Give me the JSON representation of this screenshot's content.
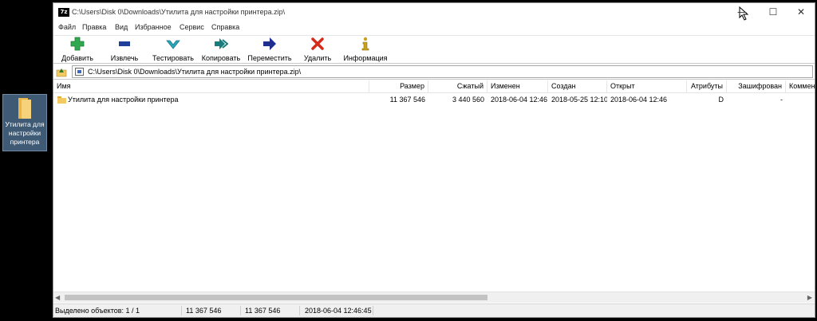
{
  "window": {
    "title": "C:\\Users\\Disk 0\\Downloads\\Утилита для настройки принтера.zip\\",
    "app_icon_text": "7z",
    "buttons": {
      "minimize": "—",
      "maximize": "☐",
      "close": "✕"
    }
  },
  "menu": [
    "Файл",
    "Правка",
    "Вид",
    "Избранное",
    "Сервис",
    "Справка"
  ],
  "toolbar": [
    {
      "label": "Добавить",
      "icon": "plus-icon",
      "color": "#2fa84f"
    },
    {
      "label": "Извлечь",
      "icon": "minus-icon",
      "color": "#1f3f9b"
    },
    {
      "label": "Тестировать",
      "icon": "check-icon",
      "color": "#2aa6b8"
    },
    {
      "label": "Копировать",
      "icon": "double-arrow-icon",
      "color": "#1a7d7d"
    },
    {
      "label": "Переместить",
      "icon": "arrow-right-icon",
      "color": "#1f2f8f"
    },
    {
      "label": "Удалить",
      "icon": "x-icon",
      "color": "#d62a1a"
    },
    {
      "label": "Информация",
      "icon": "info-icon",
      "color": "#c9a21a"
    }
  ],
  "address": {
    "path": "C:\\Users\\Disk 0\\Downloads\\Утилита для настройки принтера.zip\\"
  },
  "columns": [
    "Имя",
    "Размер",
    "Сжатый",
    "Изменен",
    "Создан",
    "Открыт",
    "Атрибуты",
    "Зашифрован",
    "Коммен"
  ],
  "rows": [
    {
      "name": "Утилита для настройки принтера",
      "size": "11 367 546",
      "packed": "3 440 560",
      "modified": "2018-06-04 12:46",
      "created": "2018-05-25 12:10",
      "opened": "2018-06-04 12:46",
      "attributes": "D",
      "encrypted": "-",
      "comment": ""
    }
  ],
  "status": {
    "selected": "Выделено объектов: 1 / 1",
    "size": "11 367 546",
    "packed": "11 367 546",
    "date": "2018-06-04 12:46:45"
  },
  "desktop_icon": {
    "label": "Утилита для настройки принтера",
    "icon": "folder-icon"
  },
  "scrollbar": {
    "left": "◀",
    "right": "▶"
  }
}
